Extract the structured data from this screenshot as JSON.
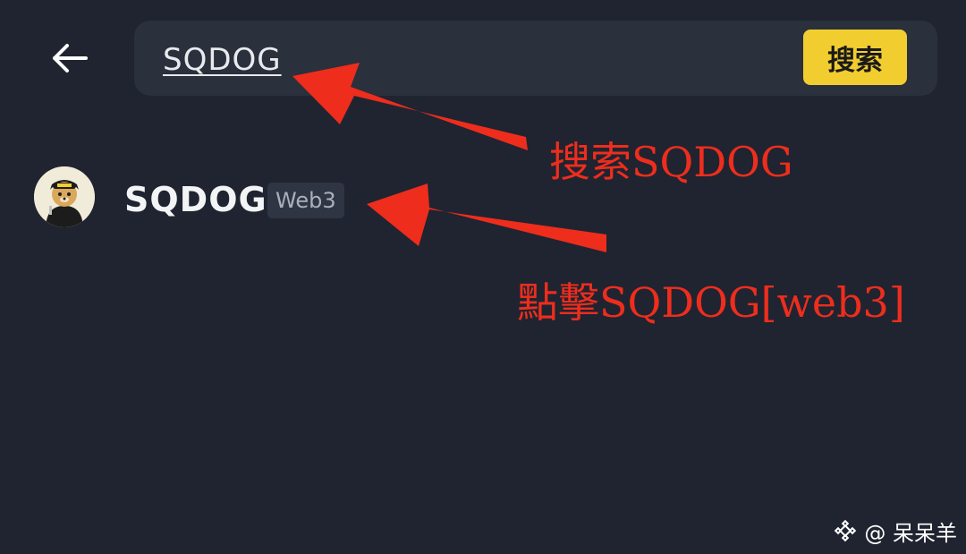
{
  "search": {
    "query": "SQDOG",
    "button_label": "搜索"
  },
  "results": [
    {
      "name": "SQDOG",
      "badge": "Web3",
      "icon": "dog-avatar"
    }
  ],
  "annotations": [
    "搜索SQDOG",
    "點擊SQDOG[web3]"
  ],
  "watermark": {
    "text": "@ 呆呆羊",
    "icon": "binance-logo-icon"
  },
  "colors": {
    "background": "#1f2430",
    "search_bg": "#2a303c",
    "accent": "#f2cd2f",
    "annotation": "#ee2d1d",
    "badge_bg": "#2f3542"
  }
}
